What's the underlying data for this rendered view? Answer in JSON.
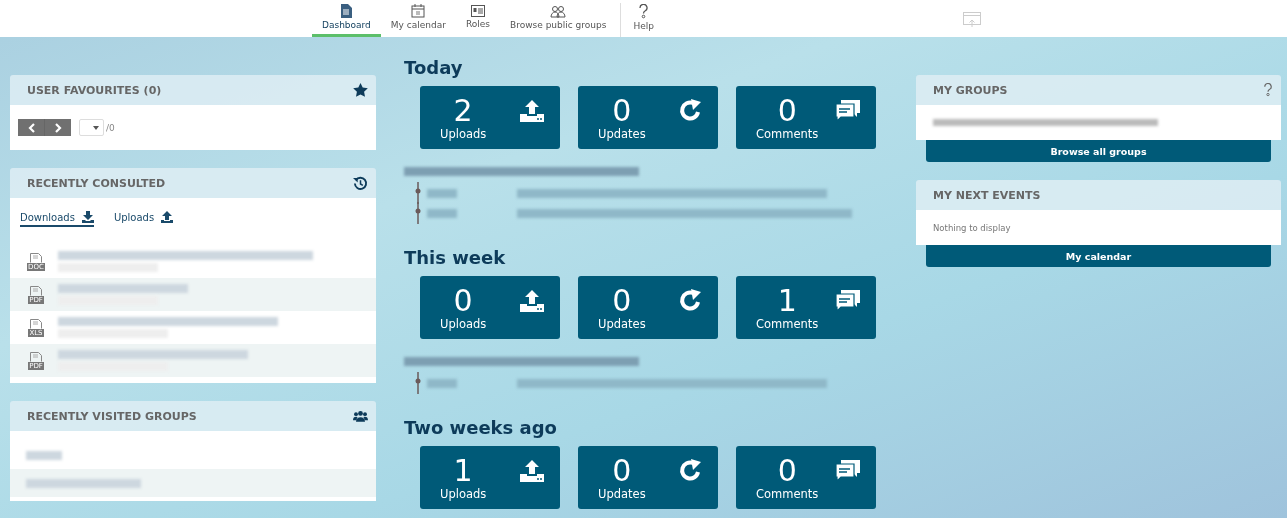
{
  "nav": {
    "items": [
      {
        "label": "Dashboard",
        "selected": true
      },
      {
        "label": "My calendar",
        "selected": false
      },
      {
        "label": "Roles",
        "selected": false
      },
      {
        "label": "Browse public groups",
        "selected": false
      },
      {
        "label": "Help",
        "selected": false
      }
    ]
  },
  "left": {
    "favourites": {
      "title": "USER FAVOURITES (0)",
      "page_total": "/0"
    },
    "recent": {
      "title": "RECENTLY CONSULTED",
      "tabs": [
        {
          "label": "Downloads",
          "selected": true
        },
        {
          "label": "Uploads",
          "selected": false
        }
      ],
      "files": [
        {
          "file_type": "DOC"
        },
        {
          "file_type": "PDF"
        },
        {
          "file_type": "XLS"
        },
        {
          "file_type": "PDF"
        }
      ]
    },
    "groups": {
      "title": "RECENTLY VISITED GROUPS",
      "items": [
        {
          "kind": "blurred"
        },
        {
          "kind": "blurred"
        }
      ]
    }
  },
  "periods": [
    {
      "title": "Today",
      "stats": [
        {
          "value": "2",
          "label": "Uploads"
        },
        {
          "value": "0",
          "label": "Updates"
        },
        {
          "value": "0",
          "label": "Comments"
        }
      ],
      "activity": [
        {
          "kind": "blurred"
        },
        {
          "kind": "blurred"
        }
      ]
    },
    {
      "title": "This week",
      "stats": [
        {
          "value": "0",
          "label": "Uploads"
        },
        {
          "value": "0",
          "label": "Updates"
        },
        {
          "value": "1",
          "label": "Comments"
        }
      ],
      "activity": [
        {
          "kind": "blurred"
        }
      ]
    },
    {
      "title": "Two weeks ago",
      "stats": [
        {
          "value": "1",
          "label": "Uploads"
        },
        {
          "value": "0",
          "label": "Updates"
        },
        {
          "value": "0",
          "label": "Comments"
        }
      ]
    }
  ],
  "right": {
    "my_groups": {
      "title": "MY GROUPS",
      "button": "Browse all groups"
    },
    "next_events": {
      "title": "MY NEXT EVENTS",
      "empty_text": "Nothing to display",
      "button": "My calendar"
    }
  }
}
